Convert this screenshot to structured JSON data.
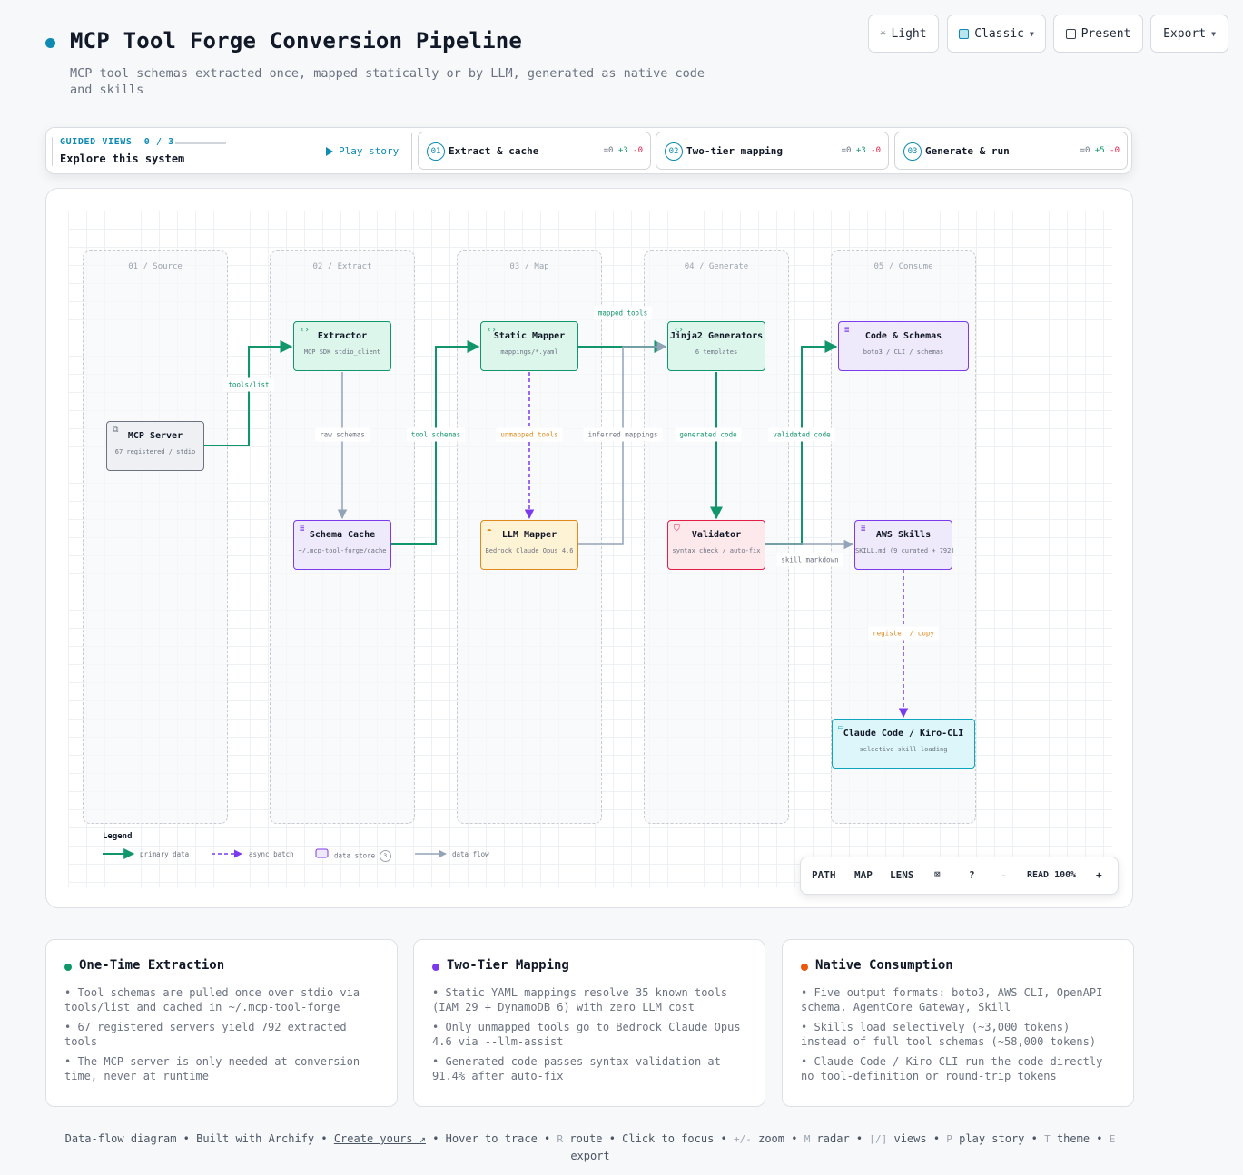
{
  "header": {
    "title": "MCP Tool Forge Conversion Pipeline",
    "subtitle": "MCP tool schemas extracted once, mapped statically or by LLM, generated as native code and skills"
  },
  "topbar": {
    "light": "Light",
    "classic": "Classic",
    "present": "Present",
    "export": "Export"
  },
  "guided": {
    "label": "GUIDED VIEWS",
    "progress": "0 / 3",
    "explore": "Explore this system",
    "play": "Play story",
    "views": [
      {
        "num": "01",
        "title": "Extract & cache",
        "s0": "=0",
        "s1": "+3",
        "s2": "-0"
      },
      {
        "num": "02",
        "title": "Two-tier mapping",
        "s0": "=0",
        "s1": "+3",
        "s2": "-0"
      },
      {
        "num": "03",
        "title": "Generate & run",
        "s0": "=0",
        "s1": "+5",
        "s2": "-0"
      }
    ]
  },
  "lanes": [
    "01 / Source",
    "02 / Extract",
    "03 / Map",
    "04 / Generate",
    "05 / Consume"
  ],
  "nodes": {
    "mcp_server": {
      "title": "MCP Server",
      "sub": "67 registered / stdio"
    },
    "extractor": {
      "title": "Extractor",
      "sub": "MCP SDK stdio_client"
    },
    "schema_cache": {
      "title": "Schema Cache",
      "sub": "~/.mcp-tool-forge/cache"
    },
    "static_mapper": {
      "title": "Static Mapper",
      "sub": "mappings/*.yaml"
    },
    "llm_mapper": {
      "title": "LLM Mapper",
      "sub": "Bedrock Claude Opus 4.6"
    },
    "jinja2": {
      "title": "Jinja2 Generators",
      "sub": "6 templates"
    },
    "validator": {
      "title": "Validator",
      "sub": "syntax check / auto-fix"
    },
    "code_schemas": {
      "title": "Code & Schemas",
      "sub": "boto3 / CLI / schemas"
    },
    "aws_skills": {
      "title": "AWS Skills",
      "sub": "SKILL.md (9 curated + 792)"
    },
    "claude_code": {
      "title": "Claude Code / Kiro-CLI",
      "sub": "selective skill loading"
    }
  },
  "edges": {
    "tools_list": "tools/list",
    "raw_schemas": "raw schemas",
    "tool_schemas": "tool schemas",
    "mapped_tools": "mapped tools",
    "unmapped_tools": "unmapped tools",
    "inferred_mappings": "inferred mappings",
    "generated_code": "generated code",
    "validated_code": "validated code",
    "skill_markdown": "skill markdown",
    "register_copy": "register / copy"
  },
  "legend": {
    "title": "Legend",
    "primary": "primary data",
    "async": "async batch",
    "store": "data store",
    "store_count": "3",
    "flow": "data flow"
  },
  "toolbar": {
    "path": "PATH",
    "map": "MAP",
    "lens": "LENS",
    "help": "?",
    "minus": "-",
    "read": "READ 100%",
    "plus": "+"
  },
  "cards": [
    {
      "title": "One-Time Extraction",
      "color": "#10966a",
      "items": [
        "• Tool schemas are pulled once over stdio via tools/list and cached in ~/.mcp-tool-forge",
        "• 67 registered servers yield 792 extracted tools",
        "• The MCP server is only needed at conversion time, never at runtime"
      ]
    },
    {
      "title": "Two-Tier Mapping",
      "color": "#7c3aed",
      "items": [
        "• Static YAML mappings resolve 35 known tools (IAM 29 + DynamoDB 6) with zero LLM cost",
        "• Only unmapped tools go to Bedrock Claude Opus 4.6 via --llm-assist",
        "• Generated code passes syntax validation at 91.4% after auto-fix"
      ]
    },
    {
      "title": "Native Consumption",
      "color": "#ea580c",
      "items": [
        "• Five output formats: boto3, AWS CLI, OpenAPI schema, AgentCore Gateway, Skill",
        "• Skills load selectively (~3,000 tokens) instead of full tool schemas (~58,000 tokens)",
        "• Claude Code / Kiro-CLI run the code directly - no tool-definition or round-trip tokens"
      ]
    }
  ],
  "footer": {
    "p1": "Data-flow diagram • Built with Archify •",
    "link": "Create yours ↗",
    "p2": "• Hover to trace •",
    "k_r": "R",
    "p3": "route • Click to focus •",
    "k_zoom": "+/-",
    "p4": "zoom •",
    "k_m": "M",
    "p5": "radar •",
    "k_views": "[/]",
    "p6": "views •",
    "k_p": "P",
    "p7": "play story •",
    "k_t": "T",
    "p8": "theme •",
    "k_e": "E",
    "p9": "export"
  },
  "colors": {
    "accent": "#0e8ab3",
    "primary_edge": "#10966a",
    "async_edge": "#7c3aed",
    "flow_edge": "#94a3b8",
    "orange": "#e08a1e"
  },
  "icons": [
    "sun-icon",
    "palette-icon",
    "present-icon",
    "play-icon",
    "code-icon",
    "database-icon",
    "server-icon",
    "cloud-icon",
    "shield-icon",
    "terminal-icon",
    "radar-icon"
  ]
}
